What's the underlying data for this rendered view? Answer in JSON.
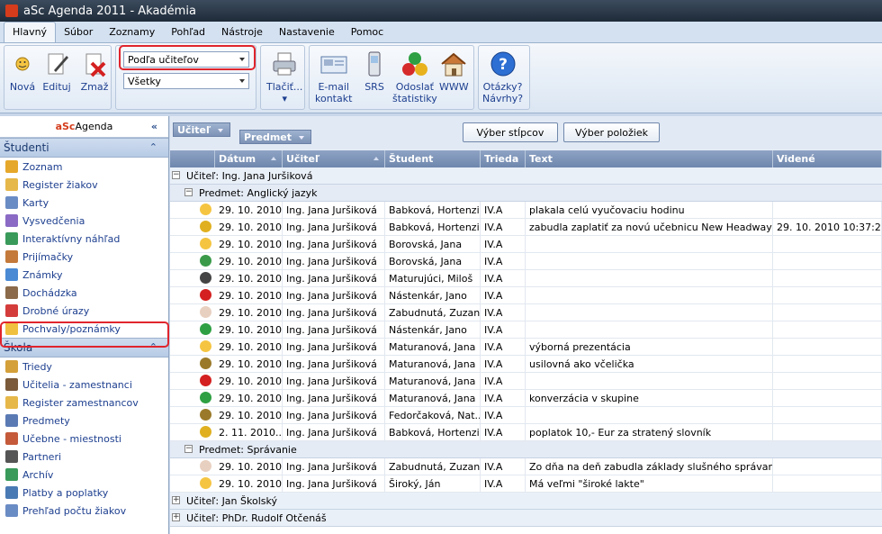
{
  "window": {
    "title": "aSc Agenda 2011 - Akadémia"
  },
  "menu": {
    "tabs": [
      "Hlavný",
      "Súbor",
      "Zoznamy",
      "Pohľad",
      "Nástroje",
      "Nastavenie",
      "Pomoc"
    ],
    "active": 0
  },
  "ribbon": {
    "nova": "Nová",
    "edituj": "Edituj",
    "zmaz": "Zmaž",
    "filter_primary": "Podľa učiteľov",
    "filter_secondary": "Všetky",
    "tlacit": "Tlačiť...",
    "tlacit_arrow": "▾",
    "email_1": "E-mail",
    "email_2": "kontakt",
    "srs": "SRS",
    "odoslat_1": "Odoslať",
    "odoslat_2": "štatistiky",
    "www": "WWW",
    "otazky_1": "Otázky?",
    "otazky_2": "Návrhy?",
    "help_glyph": "?"
  },
  "leftpanel": {
    "logo_a": "aSc",
    "logo_rest": "Agenda",
    "collapse": "«",
    "sections": [
      {
        "label": "Študenti",
        "chev": "⌃",
        "items": [
          "Zoznam",
          "Register žiakov",
          "Karty",
          "Vysvedčenia",
          "Interaktívny náhľad",
          "Prijímačky",
          "Známky",
          "Dochádzka",
          "Drobné úrazy",
          "Pochvaly/poznámky"
        ]
      },
      {
        "label": "Škola",
        "chev": "⌃",
        "items": [
          "Triedy",
          "Učitelia - zamestnanci",
          "Register zamestnancov",
          "Predmety",
          "Učebne - miestnosti",
          "Partneri",
          "Archív",
          "Platby a poplatky",
          "Prehľad počtu žiakov"
        ]
      }
    ]
  },
  "toolbar": {
    "group1": "Učiteľ",
    "group2": "Predmet",
    "vyber_stlpcov": "Výber stĺpcov",
    "vyber_poloziek": "Výber položiek"
  },
  "grid": {
    "columns": [
      "Dátum",
      "Učiteľ",
      "Študent",
      "Trieda",
      "Text",
      "Videné"
    ],
    "teacher_group_1": "Učiteľ:  Ing. Jana Juršiková",
    "subject_1": "Predmet:  Anglický jazyk",
    "subject_2": "Predmet:  Správanie",
    "teacher_group_2": "Učiteľ:  Jan Školský",
    "teacher_group_3": "Učiteľ:  PhDr. Rudolf Otčenáš",
    "expand_minus": "−",
    "expand_plus": "+",
    "rows_subject_1": [
      {
        "icon": "smiley",
        "date": "29. 10. 2010...",
        "teacher": "Ing. Jana Juršiková",
        "student": "Babková, Hortenzia",
        "class": "IV.A",
        "text": "plakala celú vyučovaciu hodinu",
        "seen": ""
      },
      {
        "icon": "coin",
        "date": "29. 10. 2010...",
        "teacher": "Ing. Jana Juršiková",
        "student": "Babková, Hortenzia",
        "class": "IV.A",
        "text": "zabudla zaplatiť za novú učebnicu New Headway",
        "seen": "29. 10. 2010 10:37:25"
      },
      {
        "icon": "smiley",
        "date": "29. 10. 2010...",
        "teacher": "Ing. Jana Juršiková",
        "student": "Borovská, Jana",
        "class": "IV.A",
        "text": "",
        "seen": ""
      },
      {
        "icon": "star",
        "date": "29. 10. 2010...",
        "teacher": "Ing. Jana Juršiková",
        "student": "Borovská, Jana",
        "class": "IV.A",
        "text": "",
        "seen": ""
      },
      {
        "icon": "ball",
        "date": "29. 10. 2010...",
        "teacher": "Ing. Jana Juršiková",
        "student": "Maturujúci, Miloš",
        "class": "IV.A",
        "text": "",
        "seen": ""
      },
      {
        "icon": "cherry",
        "date": "29. 10. 2010...",
        "teacher": "Ing. Jana Juršiková",
        "student": "Nástenkár, Jano",
        "class": "IV.A",
        "text": "",
        "seen": ""
      },
      {
        "icon": "note",
        "date": "29. 10. 2010...",
        "teacher": "Ing. Jana Juršiková",
        "student": "Zabudnutá, Zuzana",
        "class": "IV.A",
        "text": "",
        "seen": ""
      },
      {
        "icon": "plus",
        "date": "29. 10. 2010...",
        "teacher": "Ing. Jana Juršiková",
        "student": "Nástenkár, Jano",
        "class": "IV.A",
        "text": "",
        "seen": ""
      },
      {
        "icon": "smiley",
        "date": "29. 10. 2010...",
        "teacher": "Ing. Jana Juršiková",
        "student": "Maturanová, Jana",
        "class": "IV.A",
        "text": "výborná prezentácia",
        "seen": ""
      },
      {
        "icon": "bee",
        "date": "29. 10. 2010...",
        "teacher": "Ing. Jana Juršiková",
        "student": "Maturanová, Jana",
        "class": "IV.A",
        "text": "usilovná ako včelička",
        "seen": ""
      },
      {
        "icon": "cherry",
        "date": "29. 10. 2010...",
        "teacher": "Ing. Jana Juršiková",
        "student": "Maturanová, Jana",
        "class": "IV.A",
        "text": "",
        "seen": ""
      },
      {
        "icon": "plus",
        "date": "29. 10. 2010...",
        "teacher": "Ing. Jana Juršiková",
        "student": "Maturanová, Jana",
        "class": "IV.A",
        "text": "konverzácia v skupine",
        "seen": ""
      },
      {
        "icon": "bee",
        "date": "29. 10. 2010...",
        "teacher": "Ing. Jana Juršiková",
        "student": "Fedorčaková, Nat...",
        "class": "IV.A",
        "text": "",
        "seen": ""
      },
      {
        "icon": "coin",
        "date": "2. 11. 2010...",
        "teacher": "Ing. Jana Juršiková",
        "student": "Babková, Hortenzia",
        "class": "IV.A",
        "text": "poplatok 10,- Eur za stratený slovník",
        "seen": ""
      }
    ],
    "rows_subject_2": [
      {
        "icon": "note",
        "date": "29. 10. 2010...",
        "teacher": "Ing. Jana Juršiková",
        "student": "Zabudnutá, Zuzana",
        "class": "IV.A",
        "text": "Zo dňa na deň zabudla základy slušného správania",
        "seen": ""
      },
      {
        "icon": "smiley",
        "date": "29. 10. 2010...",
        "teacher": "Ing. Jana Juršiková",
        "student": "Široký, Ján",
        "class": "IV.A",
        "text": "Má veľmi \"široké lakte\"",
        "seen": ""
      }
    ]
  },
  "colors": {
    "accent": "#1d3f8f",
    "highlight": "#e0252d"
  }
}
